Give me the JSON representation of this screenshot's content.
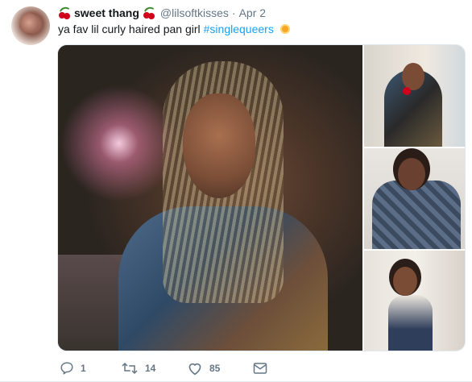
{
  "tweet": {
    "display_name": "sweet thang",
    "handle": "@lilsoftkisses",
    "separator": "·",
    "date": "Apr 2",
    "text": "ya fav lil curly haired pan girl",
    "hashtag": "#singlequeers",
    "name_emoji": "cherries",
    "text_emoji": "sun",
    "hashtag_color": "#1da1f2"
  },
  "media": {
    "photos": [
      {
        "label": "main"
      },
      {
        "label": "top-right"
      },
      {
        "label": "middle-right"
      },
      {
        "label": "bottom-right"
      }
    ]
  },
  "actions": {
    "replies": "1",
    "retweets": "14",
    "likes": "85"
  },
  "colors": {
    "muted": "#657786",
    "text": "#14171a",
    "link": "#1da1f2"
  }
}
